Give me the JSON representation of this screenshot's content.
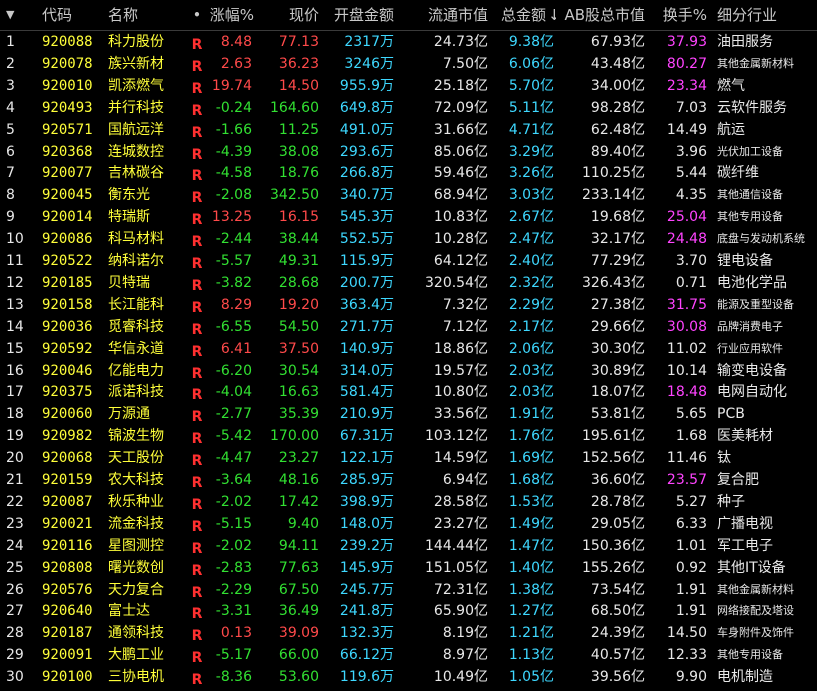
{
  "columns": {
    "idx": "▼",
    "code": "代码",
    "name": "名称",
    "flag": "•",
    "chg": "涨幅%",
    "price": "现价",
    "amount": "开盘金额",
    "float_mv": "流通市值",
    "total_amount": "总金额",
    "sort_arrow": "↓",
    "ab_mv": "AB股总市值",
    "turnover": "换手%",
    "industry": "细分行业"
  },
  "rows": [
    {
      "idx": "1",
      "code": "920088",
      "name": "科力股份",
      "flag": "R",
      "chg": "8.48",
      "price": "77.13",
      "amount": "2317万",
      "float_mv": "24.73亿",
      "total_amount": "9.38亿",
      "ab_mv": "67.93亿",
      "turnover": "37.93",
      "industry": "油田服务",
      "dir": "up",
      "hot": true,
      "small": false
    },
    {
      "idx": "2",
      "code": "920078",
      "name": "族兴新材",
      "flag": "R",
      "chg": "2.63",
      "price": "36.23",
      "amount": "3246万",
      "float_mv": "7.50亿",
      "total_amount": "6.06亿",
      "ab_mv": "43.48亿",
      "turnover": "80.27",
      "industry": "其他金属新材料",
      "dir": "up",
      "hot": true,
      "small": true
    },
    {
      "idx": "3",
      "code": "920010",
      "name": "凯添燃气",
      "flag": "R",
      "chg": "19.74",
      "price": "14.50",
      "amount": "955.9万",
      "float_mv": "25.18亿",
      "total_amount": "5.70亿",
      "ab_mv": "34.00亿",
      "turnover": "23.34",
      "industry": "燃气",
      "dir": "up",
      "hot": true,
      "small": false
    },
    {
      "idx": "4",
      "code": "920493",
      "name": "并行科技",
      "flag": "R",
      "chg": "-0.24",
      "price": "164.60",
      "amount": "649.8万",
      "float_mv": "72.09亿",
      "total_amount": "5.11亿",
      "ab_mv": "98.28亿",
      "turnover": "7.03",
      "industry": "云软件服务",
      "dir": "down",
      "hot": false,
      "small": false
    },
    {
      "idx": "5",
      "code": "920571",
      "name": "国航远洋",
      "flag": "R",
      "chg": "-1.66",
      "price": "11.25",
      "amount": "491.0万",
      "float_mv": "31.66亿",
      "total_amount": "4.71亿",
      "ab_mv": "62.48亿",
      "turnover": "14.49",
      "industry": "航运",
      "dir": "down",
      "hot": false,
      "small": false
    },
    {
      "idx": "6",
      "code": "920368",
      "name": "连城数控",
      "flag": "R",
      "chg": "-4.39",
      "price": "38.08",
      "amount": "293.6万",
      "float_mv": "85.06亿",
      "total_amount": "3.29亿",
      "ab_mv": "89.40亿",
      "turnover": "3.96",
      "industry": "光伏加工设备",
      "dir": "down",
      "hot": false,
      "small": true
    },
    {
      "idx": "7",
      "code": "920077",
      "name": "吉林碳谷",
      "flag": "R",
      "chg": "-4.58",
      "price": "18.76",
      "amount": "266.8万",
      "float_mv": "59.46亿",
      "total_amount": "3.26亿",
      "ab_mv": "110.25亿",
      "turnover": "5.44",
      "industry": "碳纤维",
      "dir": "down",
      "hot": false,
      "small": false
    },
    {
      "idx": "8",
      "code": "920045",
      "name": "衡东光",
      "flag": "R",
      "chg": "-2.08",
      "price": "342.50",
      "amount": "340.7万",
      "float_mv": "68.94亿",
      "total_amount": "3.03亿",
      "ab_mv": "233.14亿",
      "turnover": "4.35",
      "industry": "其他通信设备",
      "dir": "down",
      "hot": false,
      "small": true
    },
    {
      "idx": "9",
      "code": "920014",
      "name": "特瑞斯",
      "flag": "R",
      "chg": "13.25",
      "price": "16.15",
      "amount": "545.3万",
      "float_mv": "10.83亿",
      "total_amount": "2.67亿",
      "ab_mv": "19.68亿",
      "turnover": "25.04",
      "industry": "其他专用设备",
      "dir": "up",
      "hot": true,
      "small": true
    },
    {
      "idx": "10",
      "code": "920086",
      "name": "科马材料",
      "flag": "R",
      "chg": "-2.44",
      "price": "38.44",
      "amount": "552.5万",
      "float_mv": "10.28亿",
      "total_amount": "2.47亿",
      "ab_mv": "32.17亿",
      "turnover": "24.48",
      "industry": "底盘与发动机系统",
      "dir": "down",
      "hot": true,
      "small": true
    },
    {
      "idx": "11",
      "code": "920522",
      "name": "纳科诺尔",
      "flag": "R",
      "chg": "-5.57",
      "price": "49.31",
      "amount": "115.9万",
      "float_mv": "64.12亿",
      "total_amount": "2.40亿",
      "ab_mv": "77.29亿",
      "turnover": "3.70",
      "industry": "锂电设备",
      "dir": "down",
      "hot": false,
      "small": false
    },
    {
      "idx": "12",
      "code": "920185",
      "name": "贝特瑞",
      "flag": "R",
      "chg": "-3.82",
      "price": "28.68",
      "amount": "200.7万",
      "float_mv": "320.54亿",
      "total_amount": "2.32亿",
      "ab_mv": "326.43亿",
      "turnover": "0.71",
      "industry": "电池化学品",
      "dir": "down",
      "hot": false,
      "small": false
    },
    {
      "idx": "13",
      "code": "920158",
      "name": "长江能科",
      "flag": "R",
      "chg": "8.29",
      "price": "19.20",
      "amount": "363.4万",
      "float_mv": "7.32亿",
      "total_amount": "2.29亿",
      "ab_mv": "27.38亿",
      "turnover": "31.75",
      "industry": "能源及重型设备",
      "dir": "up",
      "hot": true,
      "small": true
    },
    {
      "idx": "14",
      "code": "920036",
      "name": "觅睿科技",
      "flag": "R",
      "chg": "-6.55",
      "price": "54.50",
      "amount": "271.7万",
      "float_mv": "7.12亿",
      "total_amount": "2.17亿",
      "ab_mv": "29.66亿",
      "turnover": "30.08",
      "industry": "品牌消费电子",
      "dir": "down",
      "hot": true,
      "small": true
    },
    {
      "idx": "15",
      "code": "920592",
      "name": "华信永道",
      "flag": "R",
      "chg": "6.41",
      "price": "37.50",
      "amount": "140.9万",
      "float_mv": "18.86亿",
      "total_amount": "2.06亿",
      "ab_mv": "30.30亿",
      "turnover": "11.02",
      "industry": "行业应用软件",
      "dir": "up",
      "hot": false,
      "small": true
    },
    {
      "idx": "16",
      "code": "920046",
      "name": "亿能电力",
      "flag": "R",
      "chg": "-6.20",
      "price": "30.54",
      "amount": "314.0万",
      "float_mv": "19.57亿",
      "total_amount": "2.03亿",
      "ab_mv": "30.89亿",
      "turnover": "10.14",
      "industry": "输变电设备",
      "dir": "down",
      "hot": false,
      "small": false
    },
    {
      "idx": "17",
      "code": "920375",
      "name": "派诺科技",
      "flag": "R",
      "chg": "-4.04",
      "price": "16.63",
      "amount": "581.4万",
      "float_mv": "10.80亿",
      "total_amount": "2.03亿",
      "ab_mv": "18.07亿",
      "turnover": "18.48",
      "industry": "电网自动化",
      "dir": "down",
      "hot": true,
      "small": false
    },
    {
      "idx": "18",
      "code": "920060",
      "name": "万源通",
      "flag": "R",
      "chg": "-2.77",
      "price": "35.39",
      "amount": "210.9万",
      "float_mv": "33.56亿",
      "total_amount": "1.91亿",
      "ab_mv": "53.81亿",
      "turnover": "5.65",
      "industry": "PCB",
      "dir": "down",
      "hot": false,
      "small": false
    },
    {
      "idx": "19",
      "code": "920982",
      "name": "锦波生物",
      "flag": "R",
      "chg": "-5.42",
      "price": "170.00",
      "amount": "67.31万",
      "float_mv": "103.12亿",
      "total_amount": "1.76亿",
      "ab_mv": "195.61亿",
      "turnover": "1.68",
      "industry": "医美耗材",
      "dir": "down",
      "hot": false,
      "small": false
    },
    {
      "idx": "20",
      "code": "920068",
      "name": "天工股份",
      "flag": "R",
      "chg": "-4.47",
      "price": "23.27",
      "amount": "122.1万",
      "float_mv": "14.59亿",
      "total_amount": "1.69亿",
      "ab_mv": "152.56亿",
      "turnover": "11.46",
      "industry": "钛",
      "dir": "down",
      "hot": false,
      "small": false
    },
    {
      "idx": "21",
      "code": "920159",
      "name": "农大科技",
      "flag": "R",
      "chg": "-3.64",
      "price": "48.16",
      "amount": "285.9万",
      "float_mv": "6.94亿",
      "total_amount": "1.68亿",
      "ab_mv": "36.60亿",
      "turnover": "23.57",
      "industry": "复合肥",
      "dir": "down",
      "hot": true,
      "small": false
    },
    {
      "idx": "22",
      "code": "920087",
      "name": "秋乐种业",
      "flag": "R",
      "chg": "-2.02",
      "price": "17.42",
      "amount": "398.9万",
      "float_mv": "28.58亿",
      "total_amount": "1.53亿",
      "ab_mv": "28.78亿",
      "turnover": "5.27",
      "industry": "种子",
      "dir": "down",
      "hot": false,
      "small": false
    },
    {
      "idx": "23",
      "code": "920021",
      "name": "流金科技",
      "flag": "R",
      "chg": "-5.15",
      "price": "9.40",
      "amount": "148.0万",
      "float_mv": "23.27亿",
      "total_amount": "1.49亿",
      "ab_mv": "29.05亿",
      "turnover": "6.33",
      "industry": "广播电视",
      "dir": "down",
      "hot": false,
      "small": false
    },
    {
      "idx": "24",
      "code": "920116",
      "name": "星图测控",
      "flag": "R",
      "chg": "-2.02",
      "price": "94.11",
      "amount": "239.2万",
      "float_mv": "144.44亿",
      "total_amount": "1.47亿",
      "ab_mv": "150.36亿",
      "turnover": "1.01",
      "industry": "军工电子",
      "dir": "down",
      "hot": false,
      "small": false
    },
    {
      "idx": "25",
      "code": "920808",
      "name": "曙光数创",
      "flag": "R",
      "chg": "-2.83",
      "price": "77.63",
      "amount": "145.9万",
      "float_mv": "151.05亿",
      "total_amount": "1.40亿",
      "ab_mv": "155.26亿",
      "turnover": "0.92",
      "industry": "其他IT设备",
      "dir": "down",
      "hot": false,
      "small": false
    },
    {
      "idx": "26",
      "code": "920576",
      "name": "天力复合",
      "flag": "R",
      "chg": "-2.29",
      "price": "67.50",
      "amount": "245.7万",
      "float_mv": "72.31亿",
      "total_amount": "1.38亿",
      "ab_mv": "73.54亿",
      "turnover": "1.91",
      "industry": "其他金属新材料",
      "dir": "down",
      "hot": false,
      "small": true
    },
    {
      "idx": "27",
      "code": "920640",
      "name": "富士达",
      "flag": "R",
      "chg": "-3.31",
      "price": "36.49",
      "amount": "241.8万",
      "float_mv": "65.90亿",
      "total_amount": "1.27亿",
      "ab_mv": "68.50亿",
      "turnover": "1.91",
      "industry": "网络接配及塔设",
      "dir": "down",
      "hot": false,
      "small": true
    },
    {
      "idx": "28",
      "code": "920187",
      "name": "通领科技",
      "flag": "R",
      "chg": "0.13",
      "price": "39.09",
      "amount": "132.3万",
      "float_mv": "8.19亿",
      "total_amount": "1.21亿",
      "ab_mv": "24.39亿",
      "turnover": "14.50",
      "industry": "车身附件及饰件",
      "dir": "up",
      "hot": false,
      "small": true
    },
    {
      "idx": "29",
      "code": "920091",
      "name": "大鹏工业",
      "flag": "R",
      "chg": "-5.17",
      "price": "66.00",
      "amount": "66.12万",
      "float_mv": "8.97亿",
      "total_amount": "1.13亿",
      "ab_mv": "40.57亿",
      "turnover": "12.33",
      "industry": "其他专用设备",
      "dir": "down",
      "hot": false,
      "small": true
    },
    {
      "idx": "30",
      "code": "920100",
      "name": "三协电机",
      "flag": "R",
      "chg": "-8.36",
      "price": "53.60",
      "amount": "119.6万",
      "float_mv": "10.49亿",
      "total_amount": "1.05亿",
      "ab_mv": "39.56亿",
      "turnover": "9.90",
      "industry": "电机制造",
      "dir": "down",
      "hot": false,
      "small": false
    }
  ],
  "colors": {
    "up": "#ff4a4a",
    "down": "#32e032",
    "hot_turnover": "#ff44ff",
    "code_name": "#ffff3a",
    "amount": "#3ed8ff",
    "background": "#000000"
  }
}
